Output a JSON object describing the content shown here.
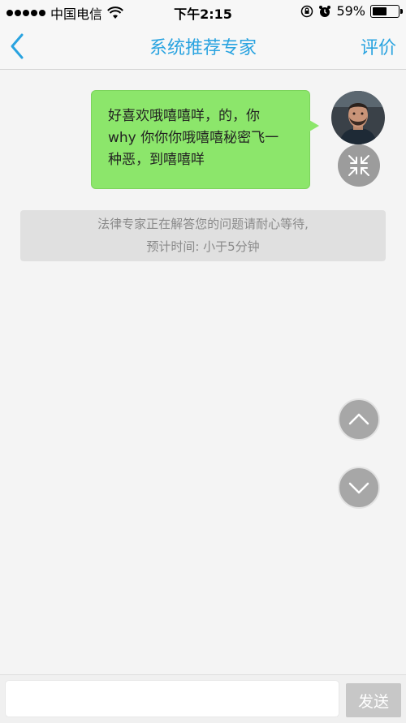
{
  "status_bar": {
    "carrier": "中国电信",
    "time": "下午2:15",
    "battery_percent": "59%",
    "battery_level": 0.59,
    "icons": [
      "signal-dots-icon",
      "wifi-icon",
      "rotation-lock-icon",
      "alarm-icon",
      "battery-icon"
    ]
  },
  "nav": {
    "back_icon": "chevron-left-icon",
    "title": "系统推荐专家",
    "rate_label": "评价"
  },
  "chat": {
    "message_lines": [
      "好喜欢哦嘻嘻咩，的，你",
      "why 你你你哦嘻嘻秘密飞一",
      "种恶，到嘻嘻咩"
    ],
    "bubble_color": "#8ce66b",
    "avatar_icon": "user-avatar",
    "collapse_icon": "collapse-arrows-icon",
    "notice_line1": "法律专家正在解答您的问题请耐心等待,",
    "notice_line2": "预计时间: 小于5分钟"
  },
  "scroll": {
    "up_icon": "chevron-up-icon",
    "down_icon": "chevron-down-icon"
  },
  "input": {
    "placeholder": "",
    "value": "",
    "send_label": "发送"
  },
  "colors": {
    "accent": "#29a3e0",
    "send_button": "#c7c7c7"
  }
}
